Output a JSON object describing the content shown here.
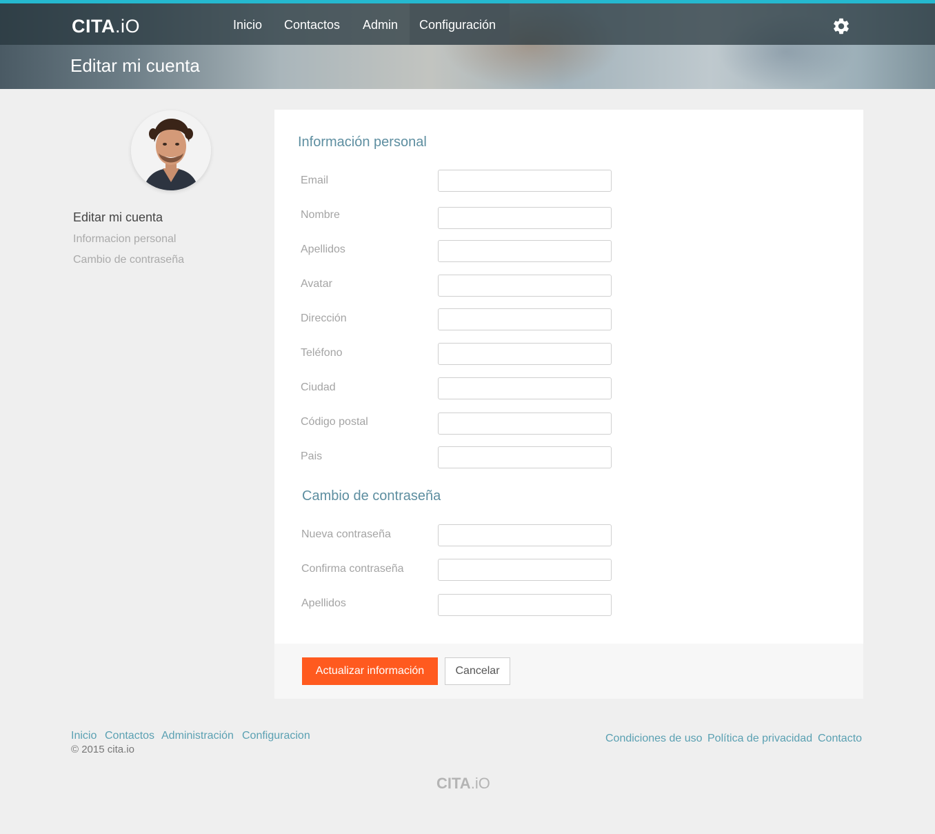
{
  "header": {
    "logo": {
      "bold": "CITA",
      "light": ".iO"
    },
    "nav": [
      {
        "label": "Inicio"
      },
      {
        "label": "Contactos"
      },
      {
        "label": "Admin"
      },
      {
        "label": "Configuración",
        "active": true
      }
    ],
    "page_title": "Editar mi cuenta",
    "settings_icon": "gear-icon",
    "accent_color": "#25b8cf"
  },
  "sidebar": {
    "title": "Editar mi cuenta",
    "links": [
      {
        "label": "Informacion personal"
      },
      {
        "label": "Cambio de contraseña"
      }
    ]
  },
  "form": {
    "personal": {
      "title": "Información personal",
      "fields": [
        {
          "label": "Email",
          "value": ""
        },
        {
          "label": "Nombre",
          "value": ""
        },
        {
          "label": "Apellidos",
          "value": ""
        },
        {
          "label": "Avatar",
          "value": ""
        },
        {
          "label": "Dirección",
          "value": ""
        },
        {
          "label": "Teléfono",
          "value": ""
        },
        {
          "label": "Ciudad",
          "value": ""
        },
        {
          "label": "Código postal",
          "value": ""
        },
        {
          "label": "Pais",
          "value": ""
        }
      ]
    },
    "password": {
      "title": "Cambio de contraseña",
      "fields": [
        {
          "label": "Nueva contraseña",
          "value": ""
        },
        {
          "label": "Confirma contraseña",
          "value": ""
        },
        {
          "label": "Apellidos",
          "value": ""
        }
      ]
    },
    "submit_label": "Actualizar información",
    "cancel_label": "Cancelar",
    "submit_color": "#ff5a1f"
  },
  "footer": {
    "left_links": [
      {
        "label": "Inicio"
      },
      {
        "label": "Contactos"
      },
      {
        "label": "Administración"
      },
      {
        "label": "Configuracion"
      }
    ],
    "right_links": [
      {
        "label": "Condiciones de uso"
      },
      {
        "label": "Política de privacidad"
      },
      {
        "label": "Contacto"
      }
    ],
    "copyright": "© 2015 cita.io",
    "logo": {
      "bold": "CITA",
      "light": ".iO"
    }
  }
}
